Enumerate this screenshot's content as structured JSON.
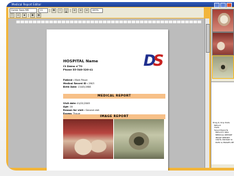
{
  "window": {
    "title": "Medical Report Editor"
  },
  "toolbar": {
    "font": "Comic Sans MS",
    "size": "11",
    "bold": "B",
    "italic": "I",
    "underline": "U",
    "zoom": "100%"
  },
  "report": {
    "hospital_name": "HOSPITAL Name",
    "address": "Ct Demo n°70",
    "phone": "Phone 55-546-326-41",
    "logo_text": "DS",
    "patient_label": "Patient :",
    "patient_value": "Mark Pesce",
    "record_label": "Medical Record ID :",
    "record_value": "2903",
    "birth_label": "Birth Date:",
    "birth_value": "15/05/1988",
    "medical_report_title": "MEDICAL REPORT",
    "visit_date_label": "Visit date:",
    "visit_date_value": "01/01/2005",
    "age_label": "Age:",
    "age_value": "16",
    "reason_label": "Reason for visit :",
    "reason_value": "Second visit",
    "exams_label": "Exams:",
    "exams_value": "Tissue",
    "image_report_title": "IMAGE REPORT"
  },
  "tree": {
    "items": [
      "Drag & drop Data",
      "Patient",
      "Visits",
      "Saved Reports",
      "Patient's data",
      "MEDICAL REPORT",
      "IMAGE REPORT",
      "VISITS HISTORY R",
      "DATA & IMAGES RE"
    ]
  }
}
